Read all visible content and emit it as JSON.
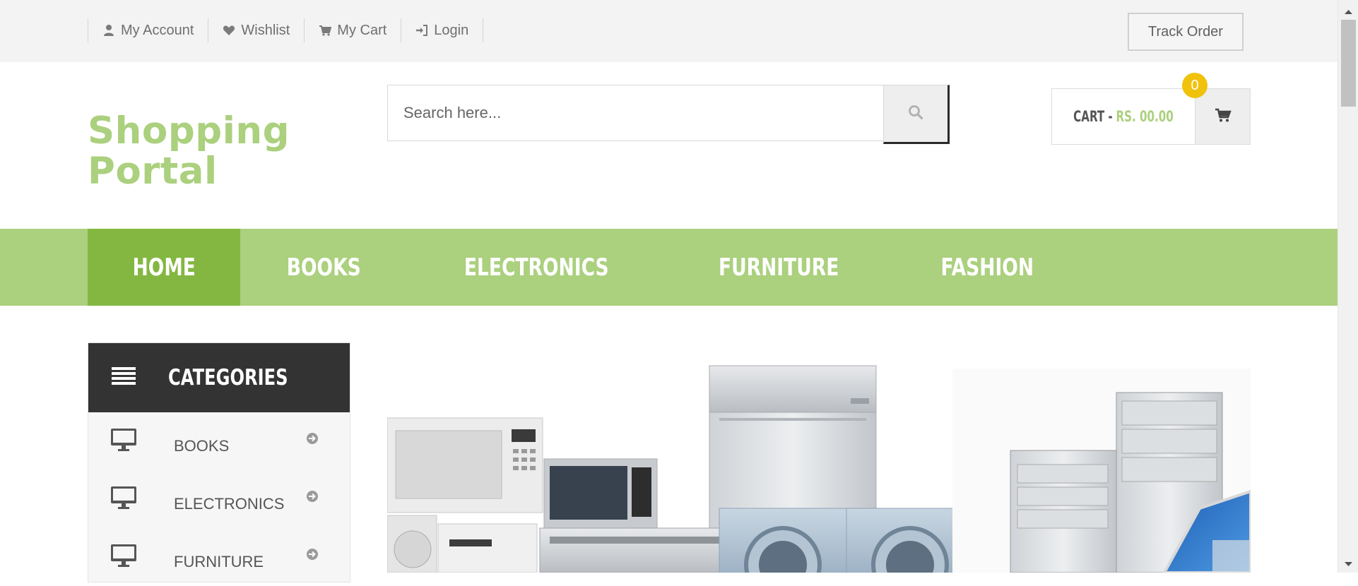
{
  "topbar": {
    "links": [
      {
        "label": "My Account",
        "icon": "user-icon"
      },
      {
        "label": "Wishlist",
        "icon": "heart-icon"
      },
      {
        "label": "My Cart",
        "icon": "cart-icon"
      },
      {
        "label": "Login",
        "icon": "sign-in-icon"
      }
    ],
    "track_order_label": "Track Order"
  },
  "header": {
    "logo_line1": "Shopping",
    "logo_line2": "Portal",
    "search_placeholder": "Search here...",
    "cart_label": "CART -",
    "cart_amount": "RS. 00.00",
    "cart_count": "0"
  },
  "nav": {
    "items": [
      {
        "label": "HOME",
        "active": true
      },
      {
        "label": "BOOKS",
        "active": false
      },
      {
        "label": "ELECTRONICS",
        "active": false
      },
      {
        "label": "FURNITURE",
        "active": false
      },
      {
        "label": "FASHION",
        "active": false
      }
    ]
  },
  "sidebar": {
    "title": "CATEGORIES",
    "items": [
      {
        "label": "BOOKS",
        "icon": "desktop-icon"
      },
      {
        "label": "ELECTRONICS",
        "icon": "desktop-icon"
      },
      {
        "label": "FURNITURE",
        "icon": "desktop-icon"
      }
    ]
  },
  "colors": {
    "brand_green": "#abd07e",
    "active_green": "#84b741",
    "dark": "#333333",
    "badge_yellow": "#f0c20c"
  }
}
